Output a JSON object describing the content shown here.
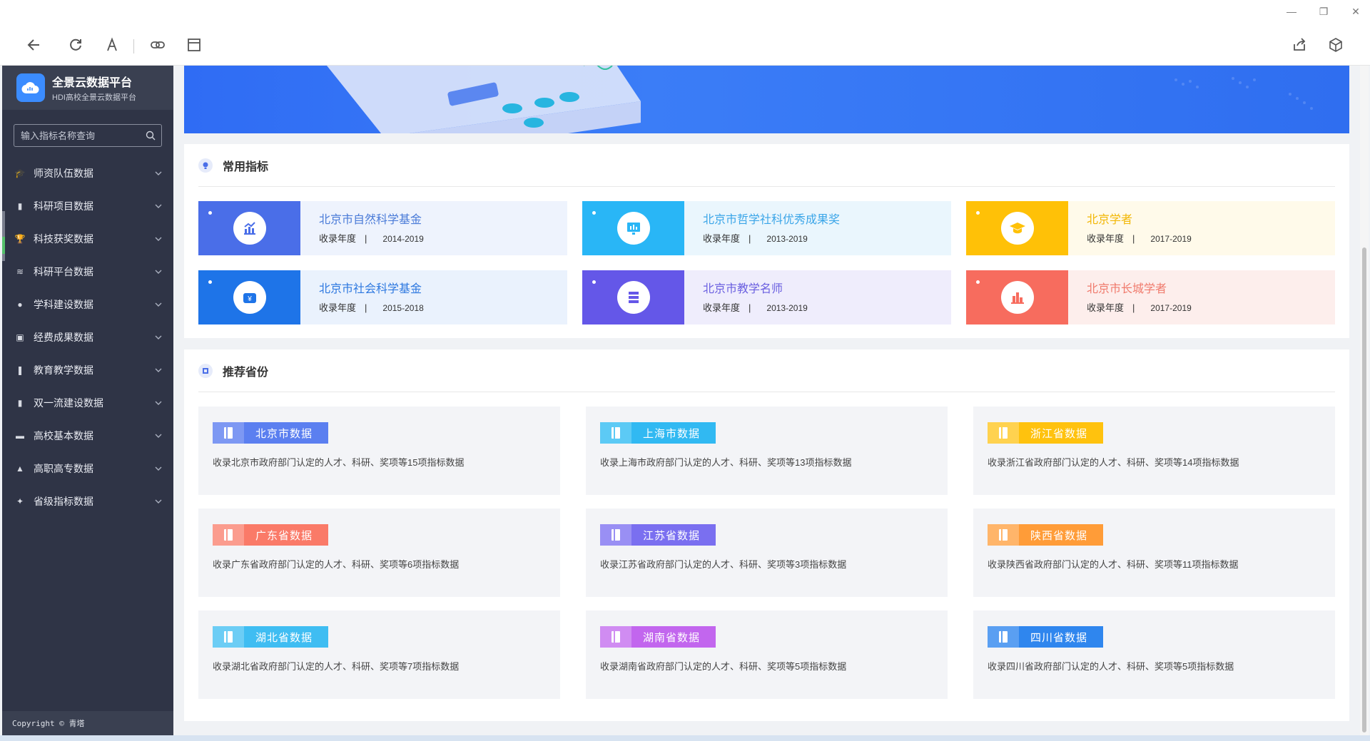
{
  "browser": {
    "window_controls": [
      "—",
      "❐",
      "✕"
    ],
    "toolbar": [
      "back-icon",
      "refresh-icon",
      "font-icon",
      "link-icon",
      "layout-icon",
      "share-icon",
      "package-icon"
    ]
  },
  "sidebar": {
    "brand_name": "全景云数据平台",
    "brand_sub": "HDI高校全景云数据平台",
    "search_placeholder": "输入指标名称查询",
    "items": [
      {
        "label": "师资队伍数据",
        "icon": "graduation-cap-icon"
      },
      {
        "label": "科研项目数据",
        "icon": "document-icon"
      },
      {
        "label": "科技获奖数据",
        "icon": "trophy-icon"
      },
      {
        "label": "科研平台数据",
        "icon": "layers-icon"
      },
      {
        "label": "学科建设数据",
        "icon": "location-pin-icon"
      },
      {
        "label": "经费成果数据",
        "icon": "wallet-icon"
      },
      {
        "label": "教育教学数据",
        "icon": "books-icon"
      },
      {
        "label": "双一流建设数据",
        "icon": "file-icon"
      },
      {
        "label": "高校基本数据",
        "icon": "card-icon"
      },
      {
        "label": "高职高专数据",
        "icon": "building-icon"
      },
      {
        "label": "省级指标数据",
        "icon": "handshake-icon"
      }
    ],
    "copyright": "Copyright  © 青塔"
  },
  "common": {
    "title": "常用指标",
    "meta_label": "收录年度",
    "meta_sep": "|",
    "cards": [
      {
        "title": "北京市自然科学基金",
        "years": "2014-2019",
        "color": "#4a6ee8",
        "bg": "#eef3fd",
        "text": "#4a7bd8",
        "icon": "chart-up-icon"
      },
      {
        "title": "北京市哲学社科优秀成果奖",
        "years": "2013-2019",
        "color": "#29b6f6",
        "bg": "#eaf6fd",
        "text": "#3aa5e8",
        "icon": "monitor-chart-icon"
      },
      {
        "title": "北京学者",
        "years": "2017-2019",
        "color": "#ffc107",
        "bg": "#fffaea",
        "text": "#f2b705",
        "icon": "mortarboard-icon"
      },
      {
        "title": "北京市社会科学基金",
        "years": "2015-2018",
        "color": "#1e74e8",
        "bg": "#eaf2fd",
        "text": "#2d78e0",
        "icon": "yen-icon"
      },
      {
        "title": "北京市教学名师",
        "years": "2013-2019",
        "color": "#6457e8",
        "bg": "#efedfc",
        "text": "#6a5fe0",
        "icon": "list-icon"
      },
      {
        "title": "北京市长城学者",
        "years": "2017-2019",
        "color": "#f76c5e",
        "bg": "#fdeeec",
        "text": "#f07a6c",
        "icon": "bar-chart-icon"
      }
    ]
  },
  "provinces": {
    "title": "推荐省份",
    "cards": [
      {
        "label": "北京市数据",
        "desc": "收录北京市政府部门认定的人才、科研、奖项等15项指标数据",
        "color": "#5b7ff0",
        "light": "#7d98f3"
      },
      {
        "label": "上海市数据",
        "desc": "收录上海市政府部门认定的人才、科研、奖项等13项指标数据",
        "color": "#31b9f2",
        "light": "#5ccaf5"
      },
      {
        "label": "浙江省数据",
        "desc": "收录浙江省政府部门认定的人才、科研、奖项等14项指标数据",
        "color": "#ffc20e",
        "light": "#ffd24f"
      },
      {
        "label": "广东省数据",
        "desc": "收录广东省政府部门认定的人才、科研、奖项等6项指标数据",
        "color": "#fa7a68",
        "light": "#fb9c8e"
      },
      {
        "label": "江苏省数据",
        "desc": "收录江苏省政府部门认定的人才、科研、奖项等3项指标数据",
        "color": "#7a6ff0",
        "light": "#998ff4"
      },
      {
        "label": "陕西省数据",
        "desc": "收录陕西省政府部门认定的人才、科研、奖项等11项指标数据",
        "color": "#ff9c38",
        "light": "#ffb56a"
      },
      {
        "label": "湖北省数据",
        "desc": "收录湖北省政府部门认定的人才、科研、奖项等7项指标数据",
        "color": "#3fbdf2",
        "light": "#6ccdf5"
      },
      {
        "label": "湖南省数据",
        "desc": "收录湖南省政府部门认定的人才、科研、奖项等5项指标数据",
        "color": "#c266ee",
        "light": "#d08cf2"
      },
      {
        "label": "四川省数据",
        "desc": "收录四川省政府部门认定的人才、科研、奖项等5项指标数据",
        "color": "#2f86ee",
        "light": "#5a9ff2"
      }
    ]
  }
}
